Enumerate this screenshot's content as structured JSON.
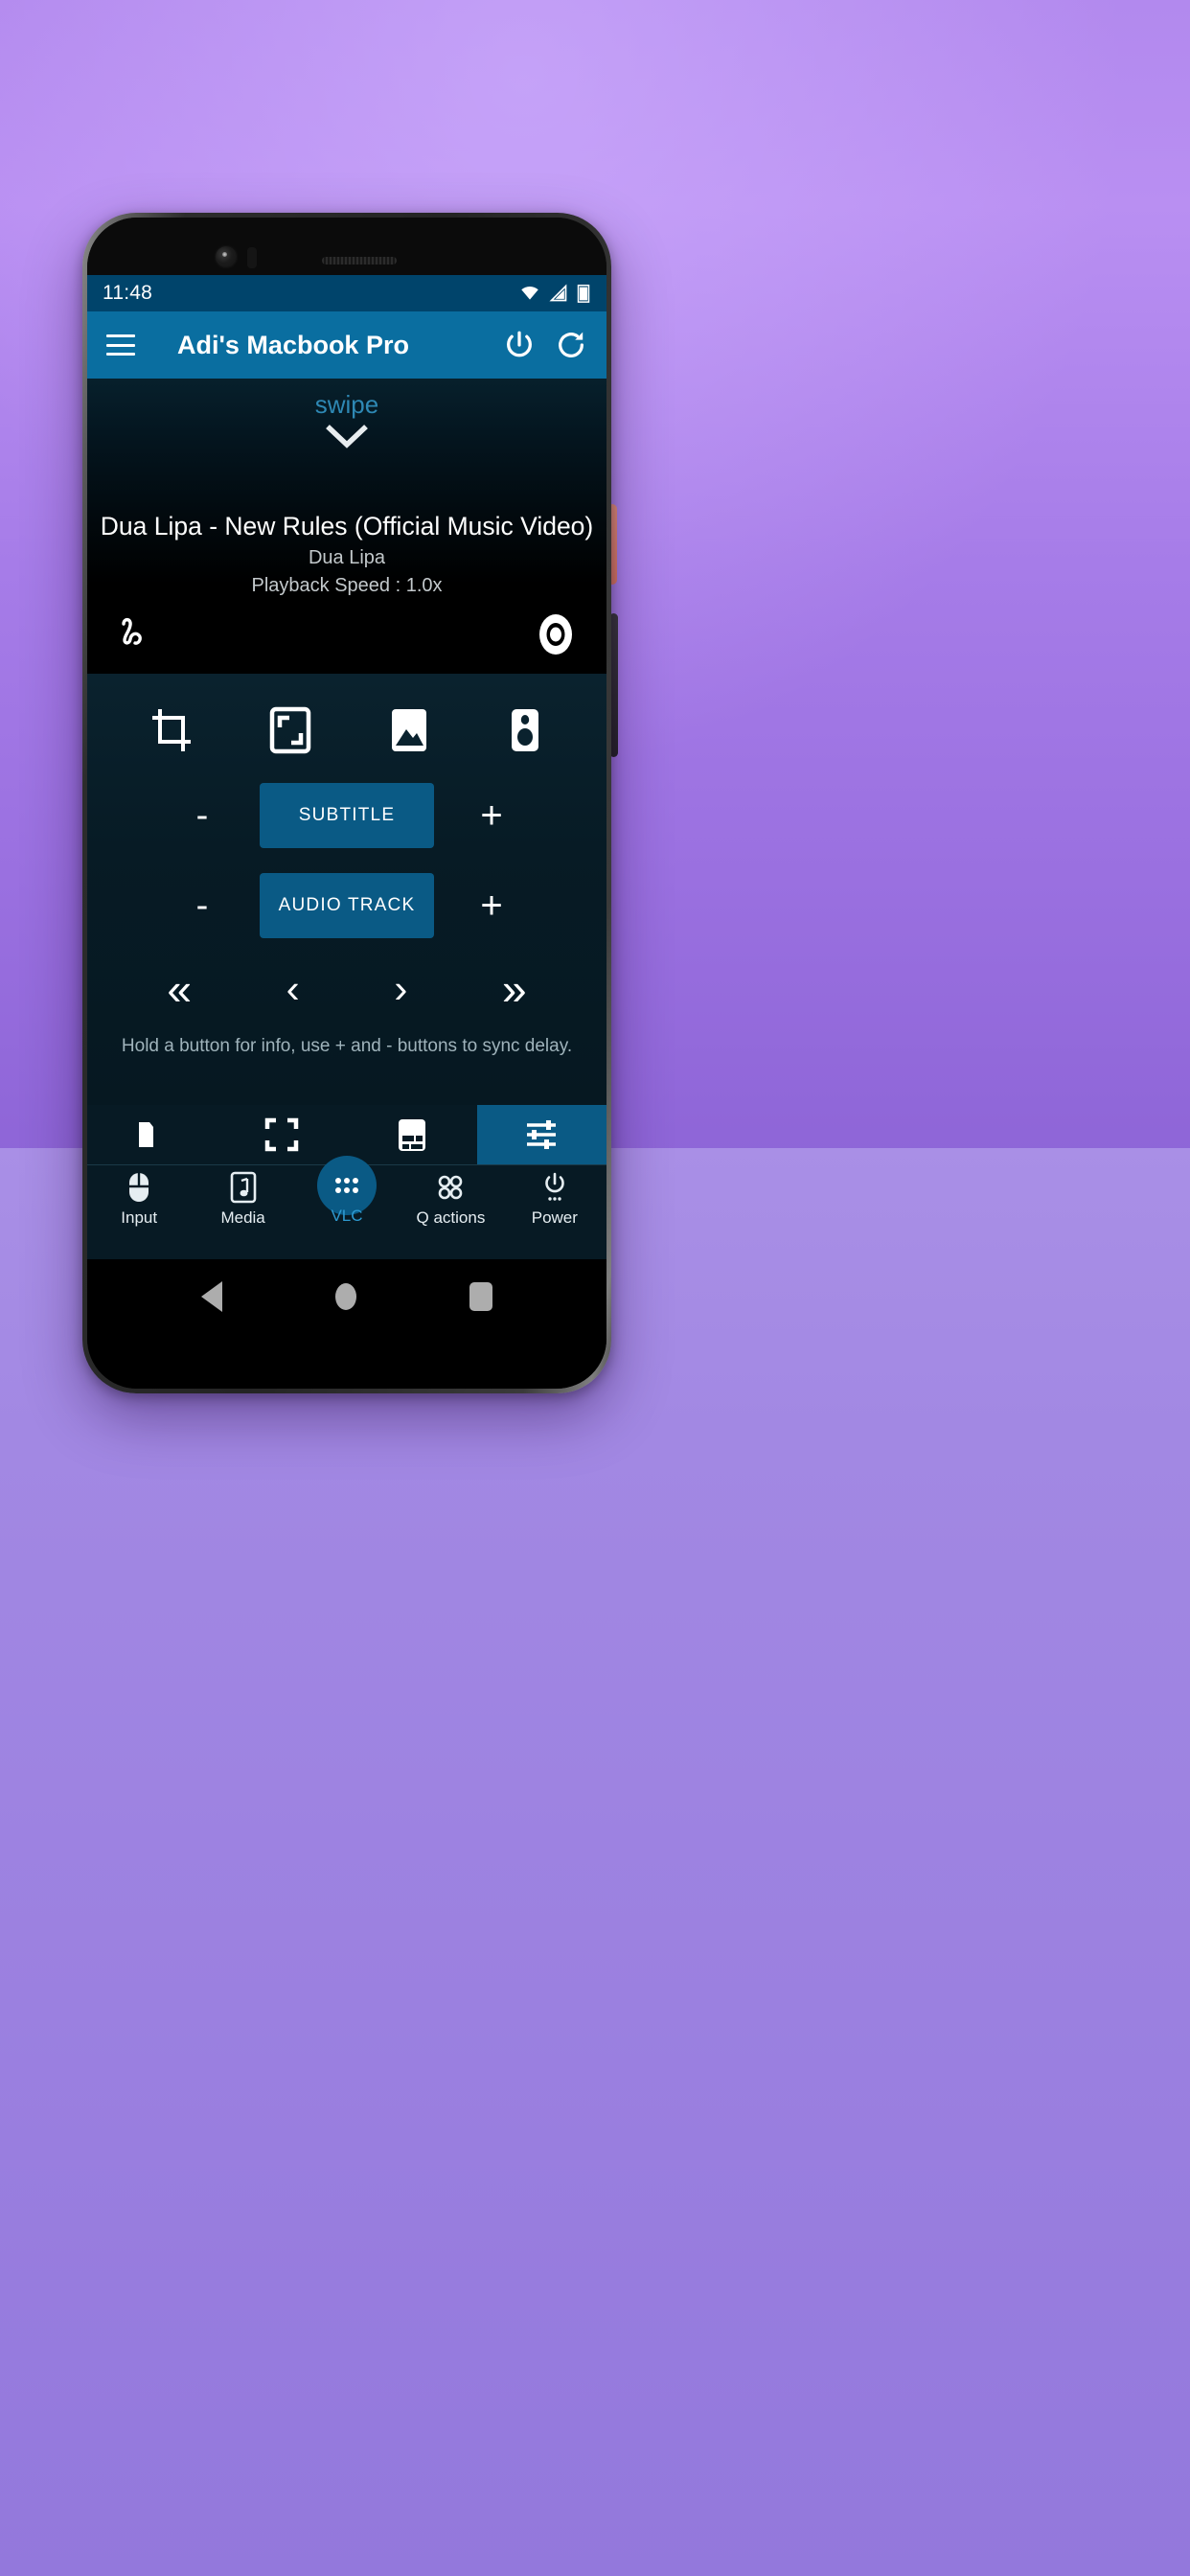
{
  "statusbar": {
    "time": "11:48",
    "icons": [
      "wifi-icon",
      "signal-icon",
      "battery-icon"
    ]
  },
  "appbar": {
    "menu_icon": "hamburger-menu-icon",
    "title": "Adi's Macbook Pro",
    "power_icon": "power-icon",
    "refresh_icon": "refresh-icon"
  },
  "media": {
    "swipe_label": "swipe",
    "swipe_chevron_icon": "chevron-down-icon",
    "title": "Dua Lipa - New Rules (Official Music Video)",
    "artist": "Dua Lipa",
    "playback_speed": "Playback Speed : 1.0x",
    "left_icon": "gesture-squiggle-icon",
    "right_icon": "record-disc-icon"
  },
  "controls": {
    "icon_row": [
      {
        "name": "crop-icon",
        "label": "Crop"
      },
      {
        "name": "aspect-ratio-icon",
        "label": "Aspect Ratio"
      },
      {
        "name": "image-icon",
        "label": "Snapshot"
      },
      {
        "name": "speaker-icon",
        "label": "Audio Device"
      }
    ],
    "subtitle": {
      "minus": "-",
      "label": "SUBTITLE",
      "plus": "+"
    },
    "audio_track": {
      "minus": "-",
      "label": "AUDIO TRACK",
      "plus": "+"
    },
    "nav_arrows": [
      {
        "name": "skip-back-icon",
        "glyph": "«"
      },
      {
        "name": "previous-icon",
        "glyph": "‹"
      },
      {
        "name": "next-icon",
        "glyph": "›"
      },
      {
        "name": "skip-forward-icon",
        "glyph": "»"
      }
    ],
    "hint": "Hold a button for info, use + and - buttons to sync delay."
  },
  "tabstrip": {
    "tabs": [
      {
        "name": "tab-browse",
        "icon": "folder-icon",
        "active": false
      },
      {
        "name": "tab-fullscreen",
        "icon": "fullscreen-icon",
        "active": false
      },
      {
        "name": "tab-subtitles",
        "icon": "subtitles-icon",
        "active": false
      },
      {
        "name": "tab-equalizer",
        "icon": "equalizer-icon",
        "active": true
      }
    ]
  },
  "bottomnav": {
    "items": [
      {
        "name": "nav-input",
        "icon": "mouse-icon",
        "label": "Input",
        "active": false
      },
      {
        "name": "nav-media",
        "icon": "music-note-icon",
        "label": "Media",
        "active": false
      },
      {
        "name": "nav-vlc",
        "icon": "grid-dots-icon",
        "label": "VLC",
        "active": true
      },
      {
        "name": "nav-qactions",
        "icon": "four-dots-icon",
        "label": "Q actions",
        "active": false
      },
      {
        "name": "nav-power",
        "icon": "power-icon",
        "label": "Power",
        "active": false
      }
    ]
  },
  "androidnav": {
    "back": "back-triangle-icon",
    "home": "home-circle-icon",
    "recents": "recents-square-icon"
  },
  "colors": {
    "accent": "#0a6ea0",
    "statusbar": "#00446b",
    "panel": "#071a24",
    "button": "#0a5a85",
    "swipe_text": "#2e88b4",
    "active_label": "#2e9ad0"
  }
}
